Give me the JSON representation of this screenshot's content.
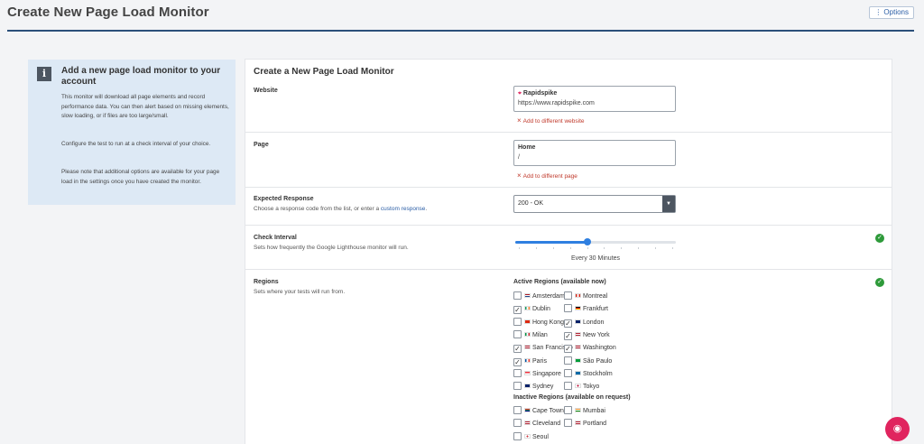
{
  "header": {
    "title": "Create New Page Load Monitor",
    "options_label": "Options"
  },
  "info": {
    "heading": "Add a new page load monitor to your account",
    "p1": "This monitor will download all page elements and record performance data. You can then alert based on missing elements, slow loading, or if files are too large/small.",
    "p2": "Configure the test to run at a check interval of your choice.",
    "p3": "Please note that additional options are available for your page load in the settings once you have created the monitor."
  },
  "form": {
    "title": "Create a New Page Load Monitor",
    "website": {
      "label": "Website",
      "name": "Rapidspike",
      "url": "https://www.rapidspike.com",
      "add_diff": "Add to different website"
    },
    "page": {
      "label": "Page",
      "name": "Home",
      "path": "/",
      "add_diff": "Add to different page"
    },
    "expected_response": {
      "label": "Expected Response",
      "desc_prefix": "Choose a response code from the list, or enter a",
      "desc_link": "custom response",
      "desc_suffix": ".",
      "value": "200 - OK"
    },
    "check_interval": {
      "label": "Check Interval",
      "desc": "Sets how frequently the Google Lighthouse monitor will run.",
      "value_text": "Every 30 Minutes",
      "slider_fraction": 0.45
    },
    "regions": {
      "label": "Regions",
      "desc": "Sets where your tests will run from.",
      "active_heading": "Active Regions (available now)",
      "inactive_heading": "Inactive Regions (available on request)",
      "active": [
        {
          "name": "Amsterdam",
          "checked": false,
          "flag": "nl"
        },
        {
          "name": "Montreal",
          "checked": false,
          "flag": "ca"
        },
        {
          "name": "Dublin",
          "checked": true,
          "flag": "ie"
        },
        {
          "name": "Frankfurt",
          "checked": false,
          "flag": "de"
        },
        {
          "name": "Hong Kong",
          "checked": false,
          "flag": "hk"
        },
        {
          "name": "London",
          "checked": true,
          "flag": "gb"
        },
        {
          "name": "Milan",
          "checked": false,
          "flag": "it"
        },
        {
          "name": "New York",
          "checked": true,
          "flag": "us"
        },
        {
          "name": "San Francisco",
          "checked": true,
          "flag": "us"
        },
        {
          "name": "Washington",
          "checked": true,
          "flag": "us"
        },
        {
          "name": "Paris",
          "checked": true,
          "flag": "fr"
        },
        {
          "name": "São Paulo",
          "checked": false,
          "flag": "br"
        },
        {
          "name": "Singapore",
          "checked": false,
          "flag": "sg"
        },
        {
          "name": "Stockholm",
          "checked": false,
          "flag": "se"
        },
        {
          "name": "Sydney",
          "checked": false,
          "flag": "au"
        },
        {
          "name": "Tokyo",
          "checked": false,
          "flag": "jp"
        }
      ],
      "inactive": [
        {
          "name": "Cape Town",
          "checked": false,
          "flag": "za"
        },
        {
          "name": "Mumbai",
          "checked": false,
          "flag": "in"
        },
        {
          "name": "Cleveland",
          "checked": false,
          "flag": "us"
        },
        {
          "name": "Portland",
          "checked": false,
          "flag": "us"
        },
        {
          "name": "Seoul",
          "checked": false,
          "flag": "kr"
        }
      ]
    }
  },
  "colors": {
    "accent": "#2b4f7a",
    "link": "#2b5ea6",
    "danger": "#c0392b",
    "success": "#2e9a3a",
    "slider": "#2f7fe0",
    "fab": "#e0245e"
  },
  "icons": {
    "options": "vertical-dots-icon",
    "info": "info-icon",
    "website": "rapidspike-logo-icon",
    "remove": "close-icon",
    "select_arrow": "caret-down-icon",
    "ok": "checkmark-circle-icon",
    "chat": "chat-icon"
  }
}
